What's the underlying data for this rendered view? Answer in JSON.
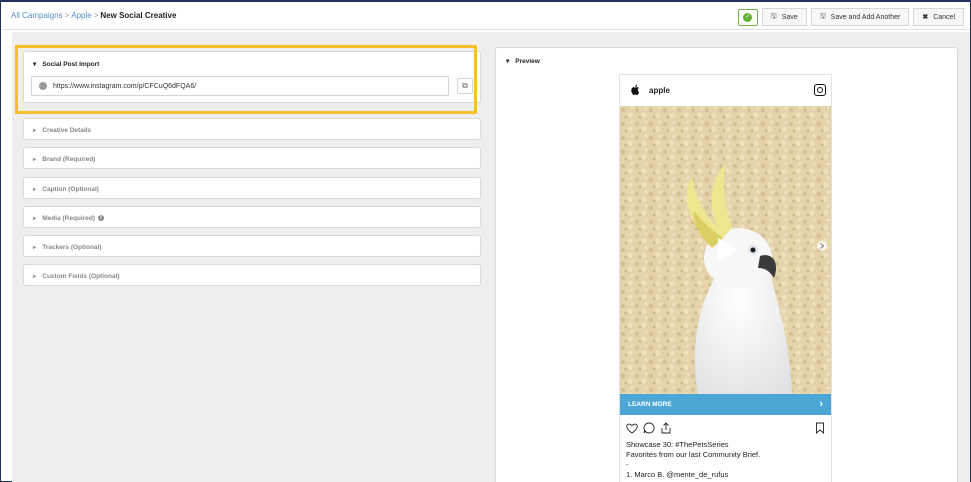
{
  "breadcrumb": {
    "items": [
      "All Campaigns",
      "Apple"
    ],
    "separator": ">",
    "current": "New Social Creative"
  },
  "toolbar": {
    "status_icon": "check-circle-icon",
    "save_label": "Save",
    "save_add_label": "Save and Add Another",
    "cancel_label": "Cancel"
  },
  "form": {
    "social_import": {
      "title": "Social Post Import",
      "url_value": "https://www.instagram.com/p/CFCuQ6dFQA6/"
    },
    "sections": [
      "Creative Details",
      "Brand (Required)",
      "Caption (Optional)",
      "Media (Required)",
      "Trackers (Optional)",
      "Custom Fields (Optional)"
    ]
  },
  "preview": {
    "title": "Preview",
    "account": "apple",
    "cta_label": "LEARN MORE",
    "caption_lines": [
      "Showcase 30: #ThePetsSeries",
      "Favorites from our last Community Brief.",
      "-",
      "1. Marco B. @mente_de_rufus"
    ]
  },
  "colors": {
    "link": "#5a8ec7",
    "highlight": "#f5c02a",
    "cta": "#4ca6d6",
    "status_green": "#5fb030"
  }
}
